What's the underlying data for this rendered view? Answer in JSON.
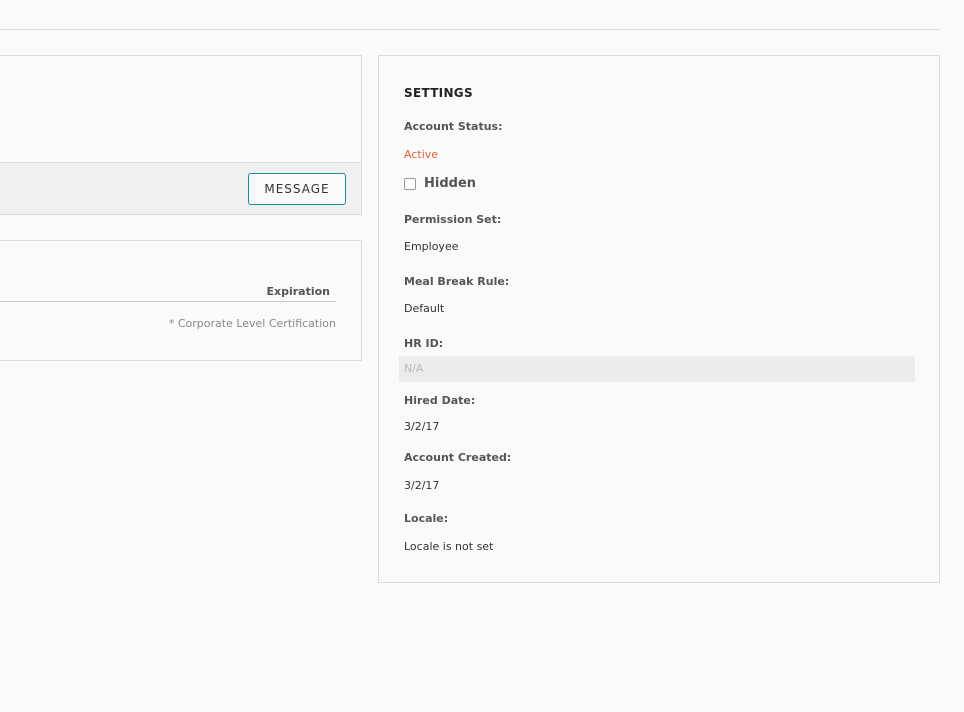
{
  "profile": {
    "message_button": "MESSAGE"
  },
  "certifications": {
    "column_expiration": "Expiration",
    "note": "* Corporate Level Certification"
  },
  "settings": {
    "title": "SETTINGS",
    "account_status_label": "Account Status:",
    "account_status_value": "Active",
    "hidden_label": "Hidden",
    "hidden_checked": false,
    "permission_set_label": "Permission Set:",
    "permission_set_value": "Employee",
    "meal_break_label": "Meal Break Rule:",
    "meal_break_value": "Default",
    "hr_id_label": "HR ID:",
    "hr_id_placeholder": "N/A",
    "hired_date_label": "Hired Date:",
    "hired_date_value": "3/2/17",
    "account_created_label": "Account Created:",
    "account_created_value": "3/2/17",
    "locale_label": "Locale:",
    "locale_value": "Locale is not set"
  },
  "colors": {
    "accent_border": "#1a8fa3",
    "status_active": "#e0633a"
  }
}
